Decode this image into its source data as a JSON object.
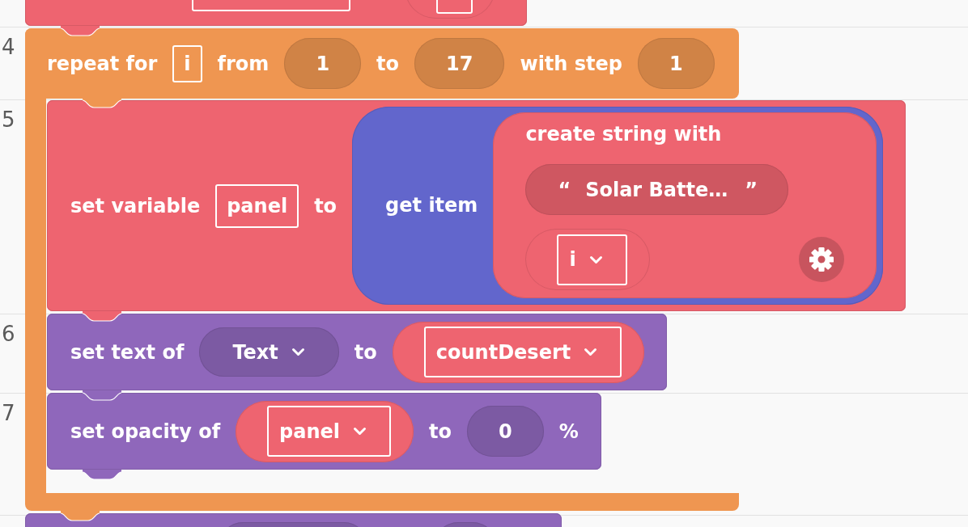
{
  "editor": {
    "line_numbers": [
      "4",
      "5",
      "6",
      "7"
    ],
    "blocks": [
      {
        "kind": "cut_top",
        "color": "#ee6470",
        "parts": [
          {
            "kind": "name_field"
          },
          {
            "kind": "variable_getter"
          }
        ]
      },
      {
        "kind": "loop",
        "color": "#ef9651",
        "parts": [
          {
            "kind": "label",
            "text": "repeat for"
          },
          {
            "kind": "name_field",
            "text": "i"
          },
          {
            "kind": "label",
            "text": "from"
          },
          {
            "kind": "number",
            "text": "1"
          },
          {
            "kind": "label",
            "text": "to"
          },
          {
            "kind": "number",
            "text": "17"
          },
          {
            "kind": "label",
            "text": "with step"
          },
          {
            "kind": "number",
            "text": "1"
          }
        ],
        "body": [
          {
            "kind": "statement",
            "color": "#ee6470",
            "parts": [
              {
                "kind": "label",
                "text": "set variable"
              },
              {
                "kind": "name_field",
                "text": "panel"
              },
              {
                "kind": "label",
                "text": "to"
              },
              {
                "kind": "block",
                "block": {
                  "kind": "value",
                  "color": "#6266cc",
                  "parts": [
                    {
                      "kind": "label",
                      "text": "get item"
                    },
                    {
                      "kind": "block",
                      "block": {
                        "kind": "value_stack",
                        "color": "#ee6470",
                        "mutator": true,
                        "parts": [
                          {
                            "kind": "label",
                            "text": "create string with"
                          },
                          {
                            "kind": "string",
                            "open_quote": "“",
                            "text": "Solar Batte…",
                            "close_quote": "”"
                          },
                          {
                            "kind": "variable_getter",
                            "text": "i"
                          }
                        ]
                      }
                    }
                  ]
                }
              }
            ]
          },
          {
            "kind": "statement",
            "color": "#8f67bb",
            "parts": [
              {
                "kind": "label",
                "text": "set text of"
              },
              {
                "kind": "component_dropdown",
                "text": "Text"
              },
              {
                "kind": "label",
                "text": "to"
              },
              {
                "kind": "variable_getter",
                "text": "countDesert"
              }
            ]
          },
          {
            "kind": "statement",
            "color": "#8f67bb",
            "parts": [
              {
                "kind": "label",
                "text": "set opacity of"
              },
              {
                "kind": "variable_getter",
                "text": "panel"
              },
              {
                "kind": "label",
                "text": "to"
              },
              {
                "kind": "number",
                "text": "0"
              },
              {
                "kind": "label",
                "text": "%"
              }
            ]
          }
        ]
      },
      {
        "kind": "cut_bottom",
        "color": "#8f67bb",
        "parts": [
          {
            "kind": "component_dropdown"
          },
          {
            "kind": "number"
          }
        ]
      }
    ]
  }
}
